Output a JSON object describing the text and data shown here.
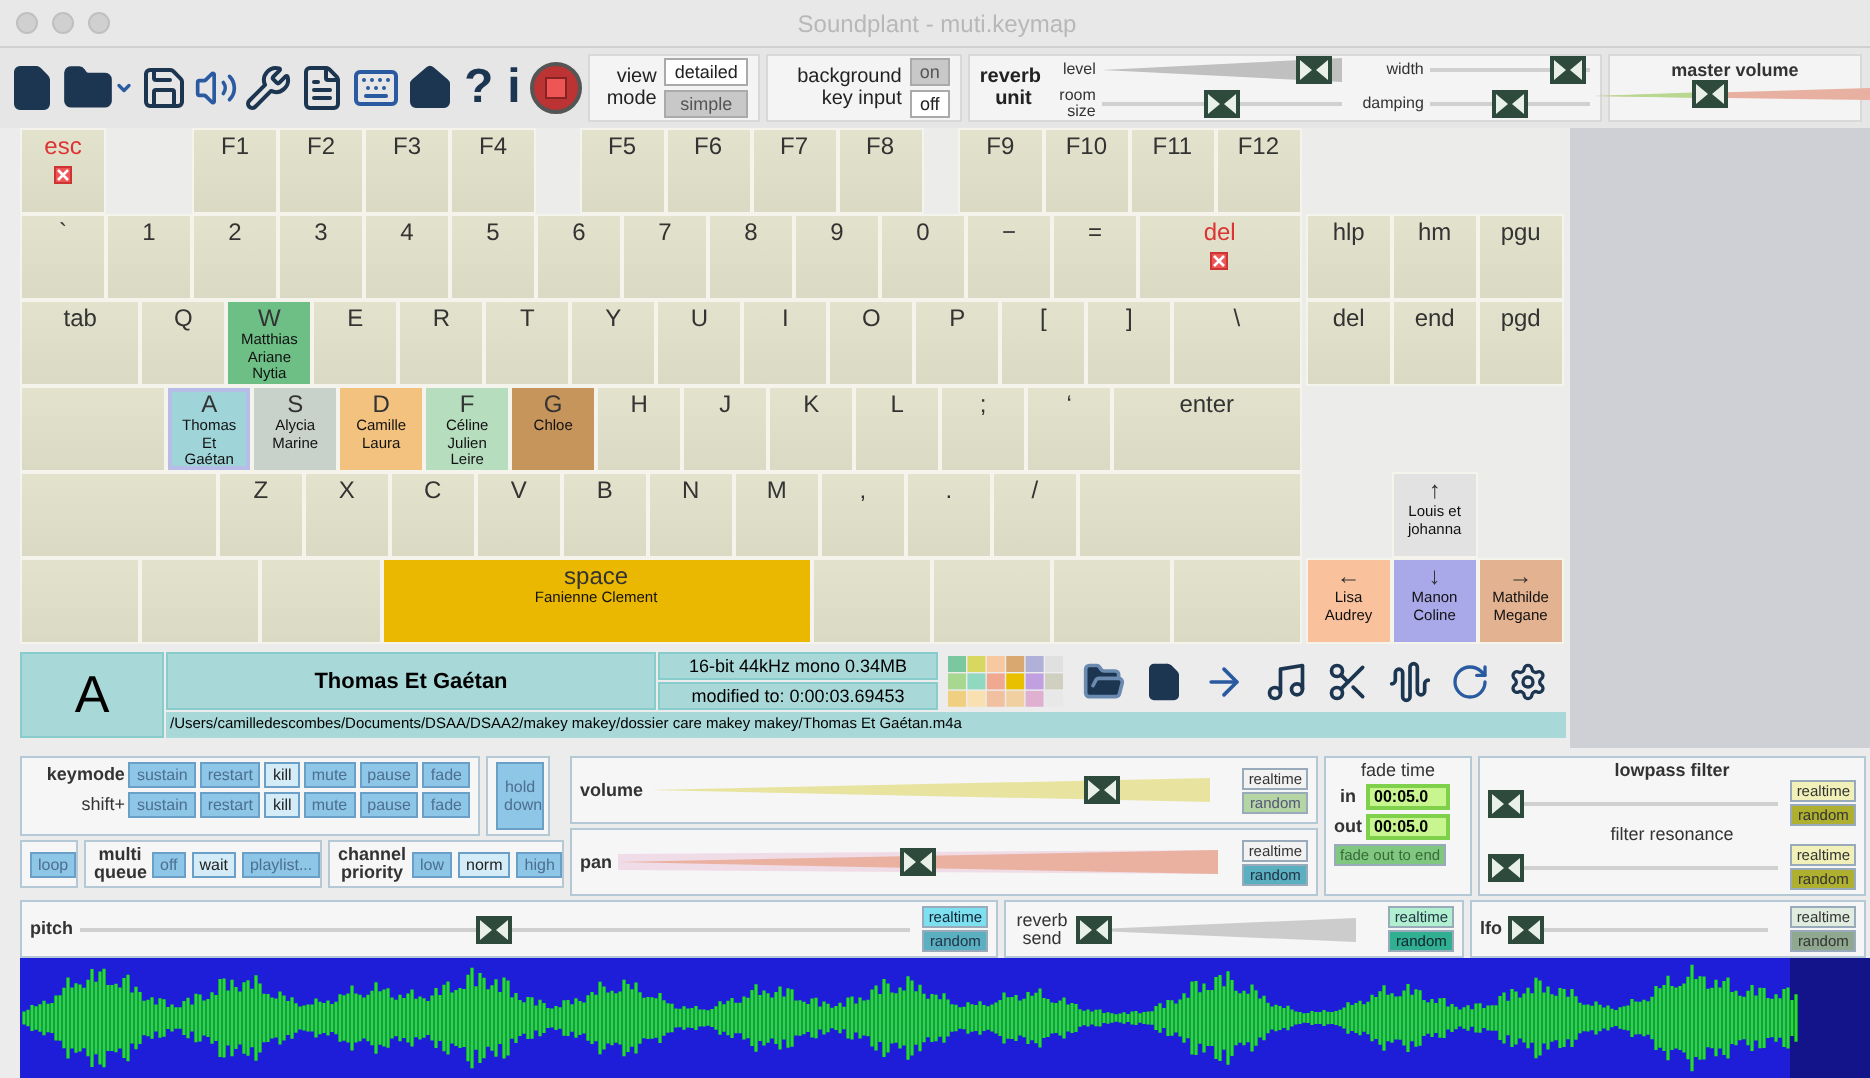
{
  "window": {
    "title": "Soundplant - muti.keymap"
  },
  "toolbar": {
    "help_label": "?",
    "info_label": "i",
    "view_mode": {
      "label": "view mode",
      "options": [
        {
          "label": "detailed",
          "selected": true
        },
        {
          "label": "simple",
          "selected": false
        }
      ]
    },
    "background_key_input": {
      "label": "background key input",
      "options": [
        {
          "label": "on",
          "selected": false
        },
        {
          "label": "off",
          "selected": true
        }
      ]
    },
    "reverb_unit": {
      "label": "reverb unit",
      "sliders": [
        {
          "label": "level",
          "level": 0.95
        },
        {
          "label": "width",
          "level": 0.97
        },
        {
          "label": "room size",
          "level": 0.5
        },
        {
          "label": "damping",
          "level": 0.5
        }
      ]
    },
    "master_volume": {
      "label": "master volume",
      "level": 0.4
    }
  },
  "keyboard": {
    "rows": [
      [
        {
          "label": "esc",
          "selected": false,
          "disabled": true
        },
        {
          "label": "F1",
          "selected": false,
          "disabled": false
        },
        {
          "label": "F2",
          "selected": false,
          "disabled": false
        },
        {
          "label": "F3",
          "selected": false,
          "disabled": false
        },
        {
          "label": "F4",
          "selected": false,
          "disabled": false
        },
        {
          "label": "F5",
          "selected": false,
          "disabled": false
        },
        {
          "label": "F6",
          "selected": false,
          "disabled": false
        },
        {
          "label": "F7",
          "selected": false,
          "disabled": false
        },
        {
          "label": "F8",
          "selected": false,
          "disabled": false
        },
        {
          "label": "F9",
          "selected": false,
          "disabled": false
        },
        {
          "label": "F10",
          "selected": false,
          "disabled": false
        },
        {
          "label": "F11",
          "selected": false,
          "disabled": false
        },
        {
          "label": "F12",
          "selected": false,
          "disabled": false
        }
      ],
      [
        {
          "label": "`",
          "selected": false,
          "disabled": false
        },
        {
          "label": "1",
          "selected": false,
          "disabled": false
        },
        {
          "label": "2",
          "selected": false,
          "disabled": false
        },
        {
          "label": "3",
          "selected": false,
          "disabled": false
        },
        {
          "label": "4",
          "selected": false,
          "disabled": false
        },
        {
          "label": "5",
          "selected": false,
          "disabled": false
        },
        {
          "label": "6",
          "selected": false,
          "disabled": false
        },
        {
          "label": "7",
          "selected": false,
          "disabled": false
        },
        {
          "label": "8",
          "selected": false,
          "disabled": false
        },
        {
          "label": "9",
          "selected": false,
          "disabled": false
        },
        {
          "label": "0",
          "selected": false,
          "disabled": false
        },
        {
          "label": "−",
          "selected": false,
          "disabled": false
        },
        {
          "label": "=",
          "selected": false,
          "disabled": false
        },
        {
          "label": "del",
          "selected": false,
          "disabled": true
        },
        {
          "label": "hlp",
          "selected": false,
          "disabled": false
        },
        {
          "label": "hm",
          "selected": false,
          "disabled": false
        },
        {
          "label": "pgu",
          "selected": false,
          "disabled": false
        }
      ],
      [
        {
          "label": "tab",
          "selected": false,
          "disabled": false
        },
        {
          "label": "Q",
          "selected": false,
          "disabled": false
        },
        {
          "label": "W",
          "sound": [
            "Matthias",
            "Ariane",
            "Nytia"
          ],
          "color": "#6dbf85",
          "selected": false,
          "disabled": false
        },
        {
          "label": "E",
          "selected": false,
          "disabled": false
        },
        {
          "label": "R",
          "selected": false,
          "disabled": false
        },
        {
          "label": "T",
          "selected": false,
          "disabled": false
        },
        {
          "label": "Y",
          "selected": false,
          "disabled": false
        },
        {
          "label": "U",
          "selected": false,
          "disabled": false
        },
        {
          "label": "I",
          "selected": false,
          "disabled": false
        },
        {
          "label": "O",
          "selected": false,
          "disabled": false
        },
        {
          "label": "P",
          "selected": false,
          "disabled": false
        },
        {
          "label": "[",
          "selected": false,
          "disabled": false
        },
        {
          "label": "]",
          "selected": false,
          "disabled": false
        },
        {
          "label": "\\",
          "selected": false,
          "disabled": false
        },
        {
          "label": "del",
          "selected": false,
          "disabled": false
        },
        {
          "label": "end",
          "selected": false,
          "disabled": false
        },
        {
          "label": "pgd",
          "selected": false,
          "disabled": false
        }
      ],
      [
        {
          "label": "A",
          "sound": [
            "Thomas",
            "Et",
            "Gaétan"
          ],
          "color": "#9fd4d8",
          "selected": true,
          "disabled": false
        },
        {
          "label": "S",
          "sound": [
            "Alycia",
            "Marine"
          ],
          "color": "#c9d1cb",
          "selected": false,
          "disabled": false
        },
        {
          "label": "D",
          "sound": [
            "Camille",
            "Laura"
          ],
          "color": "#f2c27e",
          "selected": false,
          "disabled": false
        },
        {
          "label": "F",
          "sound": [
            "Céline",
            "Julien",
            "Leire"
          ],
          "color": "#b7ddbf",
          "selected": false,
          "disabled": false
        },
        {
          "label": "G",
          "sound": [
            "Chloe"
          ],
          "color": "#c6955c",
          "selected": false,
          "disabled": false
        },
        {
          "label": "H",
          "selected": false,
          "disabled": false
        },
        {
          "label": "J",
          "selected": false,
          "disabled": false
        },
        {
          "label": "K",
          "selected": false,
          "disabled": false
        },
        {
          "label": "L",
          "selected": false,
          "disabled": false
        },
        {
          "label": ";",
          "selected": false,
          "disabled": false
        },
        {
          "label": "‘",
          "selected": false,
          "disabled": false
        },
        {
          "label": "enter",
          "selected": false,
          "disabled": false
        }
      ],
      [
        {
          "label": "Z",
          "selected": false,
          "disabled": false
        },
        {
          "label": "X",
          "selected": false,
          "disabled": false
        },
        {
          "label": "C",
          "selected": false,
          "disabled": false
        },
        {
          "label": "V",
          "selected": false,
          "disabled": false
        },
        {
          "label": "B",
          "selected": false,
          "disabled": false
        },
        {
          "label": "N",
          "selected": false,
          "disabled": false
        },
        {
          "label": "M",
          "selected": false,
          "disabled": false
        },
        {
          "label": ",",
          "selected": false,
          "disabled": false
        },
        {
          "label": ".",
          "selected": false,
          "disabled": false
        },
        {
          "label": "/",
          "selected": false,
          "disabled": false
        }
      ],
      [
        {
          "label": "space",
          "sound": [
            "Fanienne Clement"
          ],
          "color": "#eab800",
          "selected": false,
          "disabled": false
        }
      ]
    ],
    "arrows": {
      "up": {
        "label": "↑",
        "sound": [
          "Louis et",
          "johanna"
        ],
        "color": "#e2e2e2",
        "selected": false,
        "disabled": false
      },
      "left": {
        "label": "←",
        "sound": [
          "Lisa",
          "Audrey"
        ],
        "color": "#f9c29c",
        "selected": false,
        "disabled": false
      },
      "down": {
        "label": "↓",
        "sound": [
          "Manon",
          "Coline"
        ],
        "color": "#a9a9ea",
        "selected": false,
        "disabled": false
      },
      "right": {
        "label": "→",
        "sound": [
          "Mathilde",
          "Megane"
        ],
        "color": "#e3b290",
        "selected": false,
        "disabled": false
      }
    }
  },
  "info": {
    "key": "A",
    "sound_name": "Thomas Et Gaétan",
    "format": "16-bit 44kHz mono 0.34MB",
    "modified": "modified to: 0:00:03.69453",
    "path": "/Users/camilledescombes/Documents/DSAA/DSAA2/makey makey/dossier care makey makey/Thomas Et Gaétan.m4a"
  },
  "controls": {
    "keymode": {
      "label": "keymode",
      "options": [
        {
          "label": "sustain",
          "selected": false
        },
        {
          "label": "restart",
          "selected": false
        },
        {
          "label": "kill",
          "selected": true
        },
        {
          "label": "mute",
          "selected": false
        },
        {
          "label": "pause",
          "selected": false
        },
        {
          "label": "fade",
          "selected": false
        }
      ]
    },
    "shift": {
      "label": "shift+",
      "options": [
        {
          "label": "sustain",
          "selected": false
        },
        {
          "label": "restart",
          "selected": false
        },
        {
          "label": "kill",
          "selected": true
        },
        {
          "label": "mute",
          "selected": false
        },
        {
          "label": "pause",
          "selected": false
        },
        {
          "label": "fade",
          "selected": false
        }
      ]
    },
    "hold_down": "hold down",
    "loop": "loop",
    "multi_queue": {
      "label": "multi queue",
      "options": [
        {
          "label": "off",
          "selected": false
        },
        {
          "label": "wait",
          "selected": true
        },
        {
          "label": "playlist...",
          "selected": false
        }
      ]
    },
    "channel_priority": {
      "label": "channel priority",
      "options": [
        {
          "label": "low",
          "selected": false
        },
        {
          "label": "norm",
          "selected": true
        },
        {
          "label": "high",
          "selected": false
        }
      ]
    },
    "volume": {
      "label": "volume",
      "level": 0.83,
      "realtime": "realtime",
      "random": "random"
    },
    "pan": {
      "label": "pan",
      "level": 0.5,
      "realtime": "realtime",
      "random": "random"
    },
    "fade_time": {
      "label": "fade time",
      "in_label": "in",
      "in_value": "00:05.0",
      "out_label": "out",
      "out_value": "00:05.0",
      "button": "fade out to end"
    },
    "lowpass": {
      "label": "lowpass filter",
      "level": 0,
      "realtime": "realtime",
      "random": "random"
    },
    "resonance": {
      "label": "filter resonance",
      "level": 0,
      "realtime": "realtime",
      "random": "random"
    },
    "pitch": {
      "label": "pitch",
      "level": 0.5,
      "realtime": "realtime",
      "random": "random"
    },
    "reverb_send": {
      "label": "reverb send",
      "level": 0,
      "realtime": "realtime",
      "random": "random"
    },
    "lfo": {
      "label": "lfo",
      "level": 0,
      "realtime": "realtime",
      "random": "random"
    }
  }
}
